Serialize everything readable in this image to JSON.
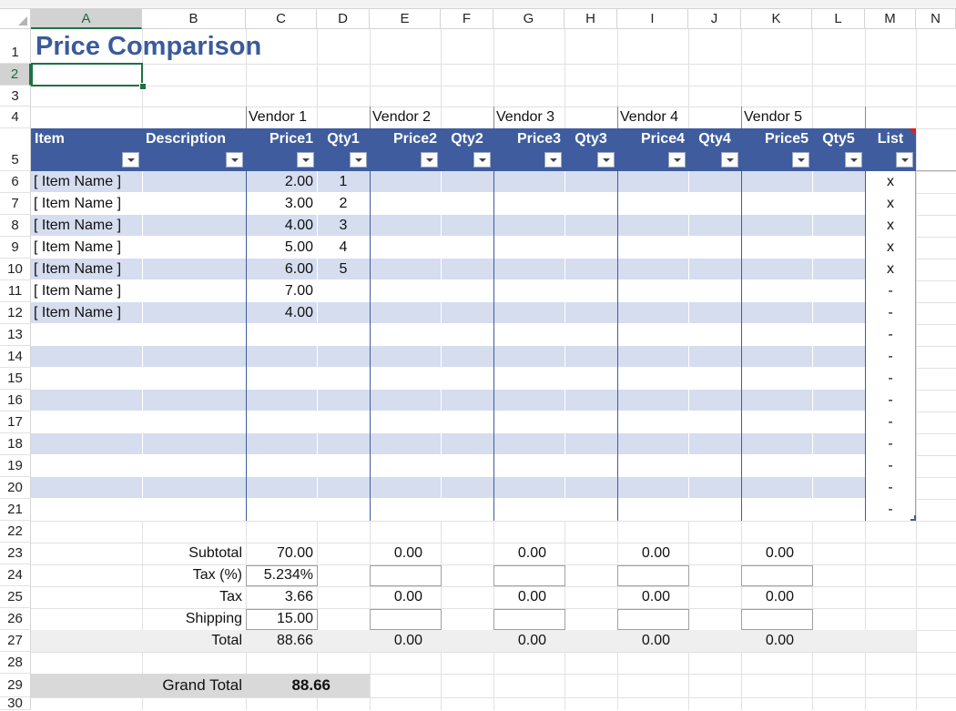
{
  "columns": [
    "A",
    "B",
    "C",
    "D",
    "E",
    "F",
    "G",
    "H",
    "I",
    "J",
    "K",
    "L",
    "M",
    "N"
  ],
  "rows": [
    "1",
    "2",
    "3",
    "4",
    "5",
    "6",
    "7",
    "8",
    "9",
    "10",
    "11",
    "12",
    "13",
    "14",
    "15",
    "16",
    "17",
    "18",
    "19",
    "20",
    "21",
    "22",
    "23",
    "24",
    "25",
    "26",
    "27",
    "28",
    "29",
    "30"
  ],
  "title": "Price Comparison",
  "vendors": [
    "Vendor 1",
    "Vendor 2",
    "Vendor 3",
    "Vendor 4",
    "Vendor 5"
  ],
  "headers": [
    "Item",
    "Description",
    "Price1",
    "Qty1",
    "Price2",
    "Qty2",
    "Price3",
    "Qty3",
    "Price4",
    "Qty4",
    "Price5",
    "Qty5",
    "List"
  ],
  "items": [
    {
      "item": "[ Item Name ]",
      "price1": "2.00",
      "qty1": "1",
      "list": "x"
    },
    {
      "item": "[ Item Name ]",
      "price1": "3.00",
      "qty1": "2",
      "list": "x"
    },
    {
      "item": "[ Item Name ]",
      "price1": "4.00",
      "qty1": "3",
      "list": "x"
    },
    {
      "item": "[ Item Name ]",
      "price1": "5.00",
      "qty1": "4",
      "list": "x"
    },
    {
      "item": "[ Item Name ]",
      "price1": "6.00",
      "qty1": "5",
      "list": "x"
    },
    {
      "item": "[ Item Name ]",
      "price1": "7.00",
      "qty1": "",
      "list": "-"
    },
    {
      "item": "[ Item Name ]",
      "price1": "4.00",
      "qty1": "",
      "list": "-"
    },
    {
      "item": "",
      "price1": "",
      "qty1": "",
      "list": "-"
    },
    {
      "item": "",
      "price1": "",
      "qty1": "",
      "list": "-"
    },
    {
      "item": "",
      "price1": "",
      "qty1": "",
      "list": "-"
    },
    {
      "item": "",
      "price1": "",
      "qty1": "",
      "list": "-"
    },
    {
      "item": "",
      "price1": "",
      "qty1": "",
      "list": "-"
    },
    {
      "item": "",
      "price1": "",
      "qty1": "",
      "list": "-"
    },
    {
      "item": "",
      "price1": "",
      "qty1": "",
      "list": "-"
    },
    {
      "item": "",
      "price1": "",
      "qty1": "",
      "list": "-"
    },
    {
      "item": "",
      "price1": "",
      "qty1": "",
      "list": "-"
    }
  ],
  "summary": {
    "subtotal_label": "Subtotal",
    "tax_pct_label": "Tax (%)",
    "tax_label": "Tax",
    "shipping_label": "Shipping",
    "total_label": "Total",
    "subtotal": [
      "70.00",
      "0.00",
      "0.00",
      "0.00",
      "0.00"
    ],
    "tax_pct": [
      "5.234%",
      "",
      "",
      "",
      ""
    ],
    "tax": [
      "3.66",
      "0.00",
      "0.00",
      "0.00",
      "0.00"
    ],
    "shipping": [
      "15.00",
      "",
      "",
      "",
      ""
    ],
    "total": [
      "88.66",
      "0.00",
      "0.00",
      "0.00",
      "0.00"
    ]
  },
  "grand_total": {
    "label": "Grand Total",
    "value": "88.66"
  },
  "colors": {
    "header_blue": "#3f5d9e",
    "band_blue": "#d5ddef",
    "title_blue": "#3a5a9c",
    "selection_green": "#1e7145"
  }
}
